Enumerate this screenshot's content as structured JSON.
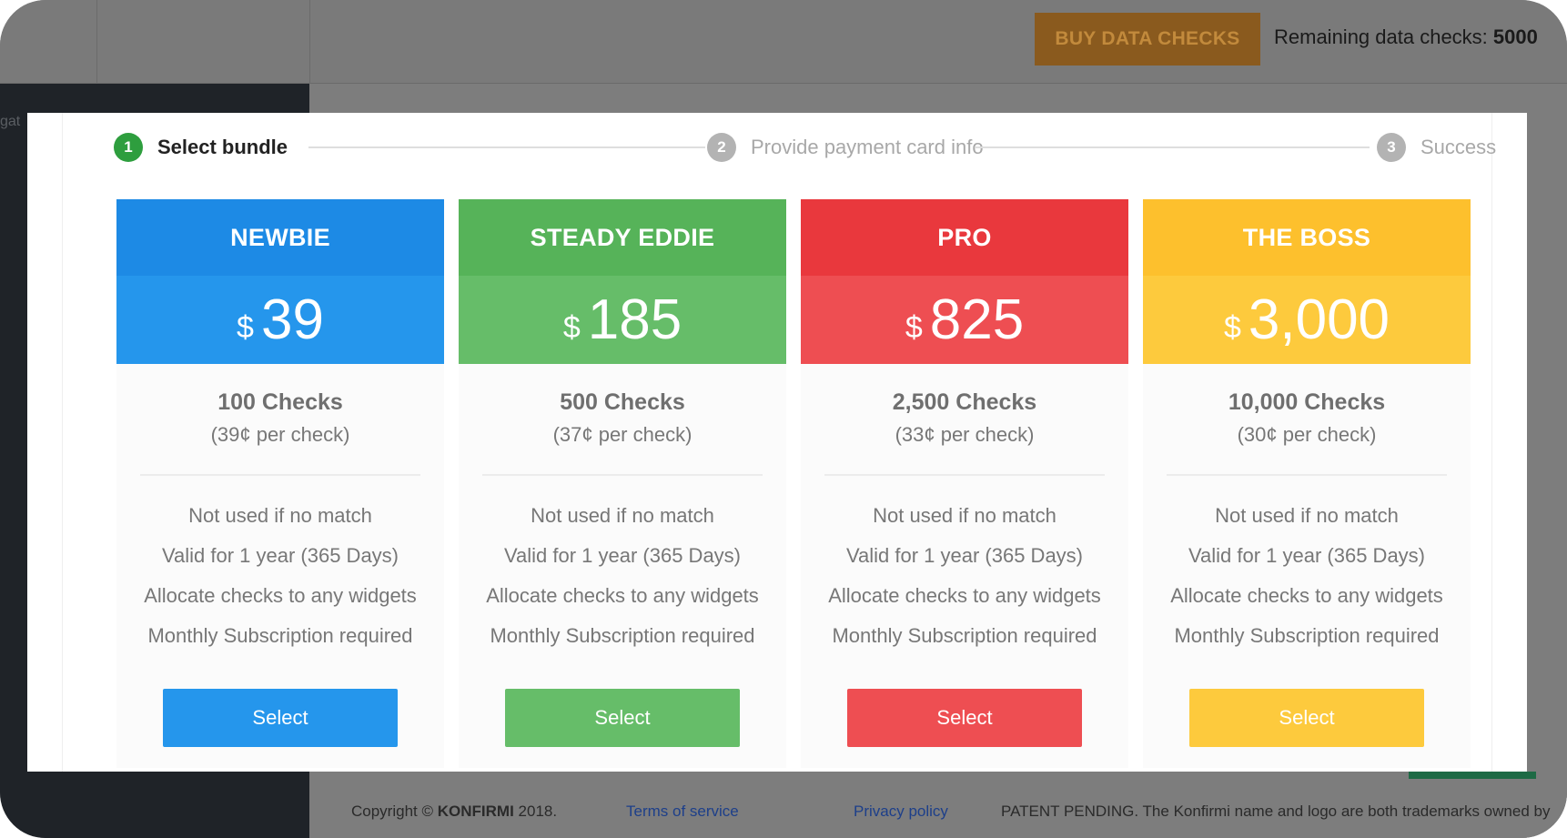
{
  "topbar": {
    "buy_label": "BUY DATA CHECKS",
    "remaining_label": "Remaining data checks:",
    "remaining_value": "5000"
  },
  "sidebar": {
    "partial_text": "gat"
  },
  "stepper": {
    "steps": [
      {
        "number": "1",
        "label": "Select bundle",
        "state": "active"
      },
      {
        "number": "2",
        "label": "Provide payment card info",
        "state": "inactive"
      },
      {
        "number": "3",
        "label": "Success",
        "state": "inactive"
      }
    ]
  },
  "bundles": [
    {
      "name": "NEWBIE",
      "currency": "$",
      "price": "39",
      "checks": "100 Checks",
      "per_check": "(39¢ per check)",
      "features": [
        "Not used if no match",
        "Valid for 1 year (365 Days)",
        "Allocate checks to any widgets",
        "Monthly Subscription required"
      ],
      "button_label": "Select",
      "color": "#2596ec"
    },
    {
      "name": "STEADY EDDIE",
      "currency": "$",
      "price": "185",
      "checks": "500 Checks",
      "per_check": "(37¢ per check)",
      "features": [
        "Not used if no match",
        "Valid for 1 year (365 Days)",
        "Allocate checks to any widgets",
        "Monthly Subscription required"
      ],
      "button_label": "Select",
      "color": "#66bd69"
    },
    {
      "name": "PRO",
      "currency": "$",
      "price": "825",
      "checks": "2,500 Checks",
      "per_check": "(33¢ per check)",
      "features": [
        "Not used if no match",
        "Valid for 1 year (365 Days)",
        "Allocate checks to any widgets",
        "Monthly Subscription required"
      ],
      "button_label": "Select",
      "color": "#ee4e52"
    },
    {
      "name": "THE BOSS",
      "currency": "$",
      "price": "3,000",
      "checks": "10,000 Checks",
      "per_check": "(30¢ per check)",
      "features": [
        "Not used if no match",
        "Valid for 1 year (365 Days)",
        "Allocate checks to any widgets",
        "Monthly Subscription required"
      ],
      "button_label": "Select",
      "color": "#fdca3d"
    }
  ],
  "footer": {
    "copyright_prefix": "Copyright ©",
    "company": "KONFIRMI",
    "year": "2018.",
    "terms_label": "Terms of service",
    "privacy_label": "Privacy policy",
    "patent_text": "PATENT PENDING. The Konfirmi name and logo are both trademarks owned by"
  }
}
